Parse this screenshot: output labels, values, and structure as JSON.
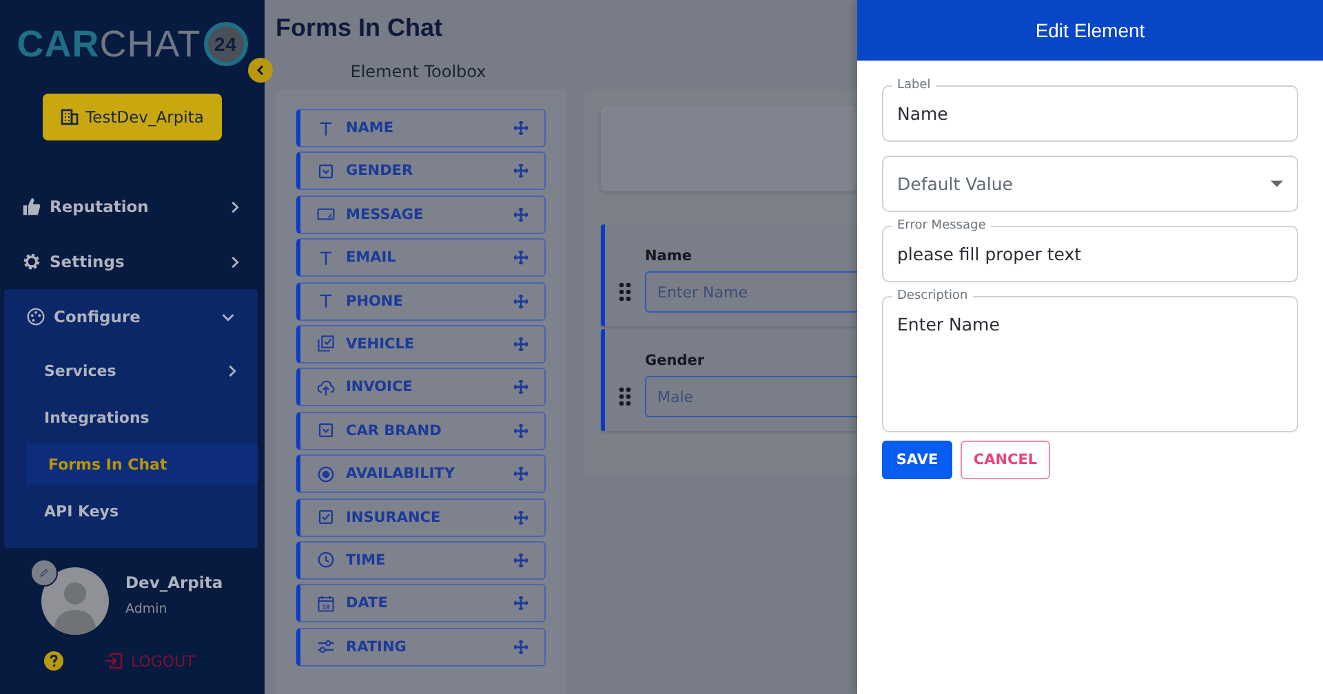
{
  "sidebar": {
    "logo": {
      "part_1": "CAR",
      "part_2": "CHAT",
      "badge": "24"
    },
    "dealer_button": "TestDev_Arpita",
    "items": [
      {
        "label": "Reputation",
        "expanded": false
      },
      {
        "label": "Settings",
        "expanded": false
      },
      {
        "label": "Configure",
        "expanded": true,
        "children": [
          {
            "label": "Services",
            "has_submenu": true,
            "selected": false
          },
          {
            "label": "Integrations",
            "has_submenu": false,
            "selected": false
          },
          {
            "label": "Forms In Chat",
            "has_submenu": false,
            "selected": true
          },
          {
            "label": "API Keys",
            "has_submenu": false,
            "selected": false
          }
        ]
      }
    ],
    "user": {
      "name": "Dev_Arpita",
      "role": "Admin"
    },
    "logout": "LOGOUT"
  },
  "page_title": "Forms In Chat",
  "toolbox": {
    "title": "Element Toolbox",
    "items": [
      {
        "label": "NAME",
        "kind": "text"
      },
      {
        "label": "GENDER",
        "kind": "select"
      },
      {
        "label": "MESSAGE",
        "kind": "textarea"
      },
      {
        "label": "EMAIL",
        "kind": "text"
      },
      {
        "label": "PHONE",
        "kind": "text"
      },
      {
        "label": "VEHICLE",
        "kind": "multi"
      },
      {
        "label": "INVOICE",
        "kind": "upload"
      },
      {
        "label": "CAR BRAND",
        "kind": "select"
      },
      {
        "label": "AVAILABILITY",
        "kind": "radio"
      },
      {
        "label": "INSURANCE",
        "kind": "checkbox"
      },
      {
        "label": "TIME",
        "kind": "time"
      },
      {
        "label": "DATE",
        "kind": "date",
        "icon_text": "19"
      },
      {
        "label": "RATING",
        "kind": "rating"
      }
    ]
  },
  "form_fields": [
    {
      "label": "Name",
      "placeholder": "Enter Name"
    },
    {
      "label": "Gender",
      "value": "Male"
    }
  ],
  "edit_panel": {
    "title": "Edit Element",
    "fields": [
      {
        "kind": "text",
        "label": "Label",
        "value": "Name"
      },
      {
        "kind": "select",
        "placeholder": "Default Value"
      },
      {
        "kind": "text",
        "label": "Error Message",
        "value": "please fill proper text"
      },
      {
        "kind": "textarea",
        "label": "Description",
        "value": "Enter Name"
      }
    ],
    "save": "SAVE",
    "cancel": "CANCEL"
  }
}
